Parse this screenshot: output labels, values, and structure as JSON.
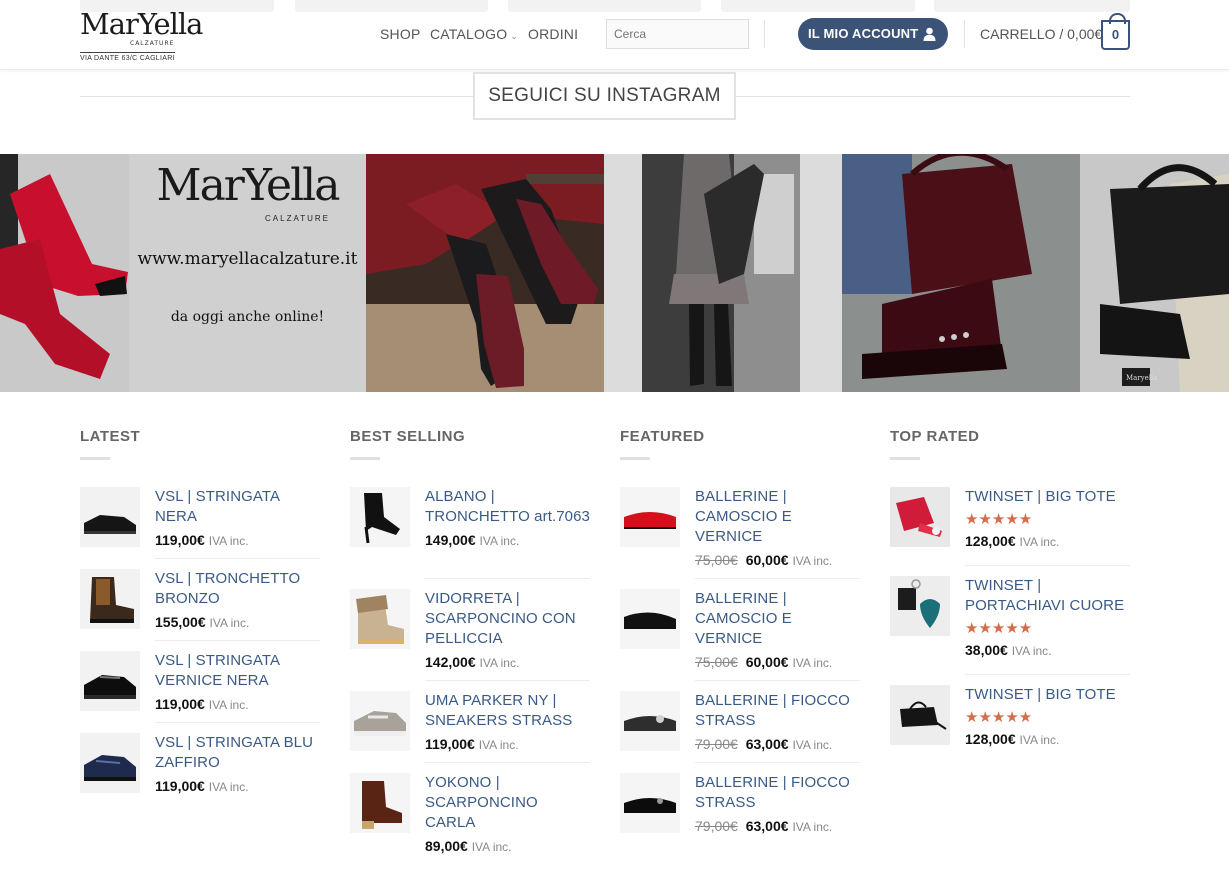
{
  "header": {
    "logo_text": "MarYella",
    "logo_subtitle": "CALZATURE",
    "logo_address": "VIA DANTE 63/C CAGLIARI",
    "nav": [
      {
        "label": "SHOP"
      },
      {
        "label": "CATALOGO"
      },
      {
        "label": "ORDINI"
      }
    ],
    "search_placeholder": "Cerca",
    "account_label": "IL MIO ACCOUNT",
    "cart_label": "CARRELLO / 0,00€",
    "cart_count": "0"
  },
  "instagram": {
    "title": "SEGUICI SU INSTAGRAM",
    "promo_logo": "MarYella",
    "promo_logo_sub": "CALZATURE",
    "promo_url": "www.maryellacalzature.it",
    "promo_tagline": "da oggi anche online!",
    "tag_label": "Maryella"
  },
  "columns": [
    {
      "title": "LATEST",
      "items": [
        {
          "name": "VSL | STRINGATA NERA",
          "price": "119,00€",
          "iva": "IVA inc."
        },
        {
          "name": "VSL | TRONCHETTO BRONZO",
          "price": "155,00€",
          "iva": "IVA inc."
        },
        {
          "name": "VSL | STRINGATA VERNICE NERA",
          "price": "119,00€",
          "iva": "IVA inc."
        },
        {
          "name": "VSL | STRINGATA BLU ZAFFIRO",
          "price": "119,00€",
          "iva": "IVA inc."
        }
      ]
    },
    {
      "title": "BEST SELLING",
      "items": [
        {
          "name": "ALBANO | TRONCHETTO art.7063",
          "price": "149,00€",
          "iva": "IVA inc."
        },
        {
          "name": "VIDORRETA | SCARPONCINO CON PELLICCIA",
          "price": "142,00€",
          "iva": "IVA inc."
        },
        {
          "name": "UMA PARKER NY | SNEAKERS STRASS",
          "price": "119,00€",
          "iva": "IVA inc."
        },
        {
          "name": "YOKONO | SCARPONCINO CARLA",
          "price": "89,00€",
          "iva": "IVA inc."
        }
      ]
    },
    {
      "title": "FEATURED",
      "items": [
        {
          "name": "BALLERINE | CAMOSCIO E VERNICE",
          "old_price": "75,00€",
          "price": "60,00€",
          "iva": "IVA inc."
        },
        {
          "name": "BALLERINE | CAMOSCIO E VERNICE",
          "old_price": "75,00€",
          "price": "60,00€",
          "iva": "IVA inc."
        },
        {
          "name": "BALLERINE | FIOCCO STRASS",
          "old_price": "79,00€",
          "price": "63,00€",
          "iva": "IVA inc."
        },
        {
          "name": "BALLERINE | FIOCCO STRASS",
          "old_price": "79,00€",
          "price": "63,00€",
          "iva": "IVA inc."
        }
      ]
    },
    {
      "title": "TOP RATED",
      "items": [
        {
          "name": "TWINSET | BIG TOTE",
          "rating": 5,
          "price": "128,00€",
          "iva": "IVA inc."
        },
        {
          "name": "TWINSET | PORTACHIAVI CUORE",
          "rating": 5,
          "price": "38,00€",
          "iva": "IVA inc."
        },
        {
          "name": "TWINSET | BIG TOTE",
          "rating": 5,
          "price": "128,00€",
          "iva": "IVA inc."
        }
      ]
    }
  ],
  "colors": {
    "accent": "#3b5377",
    "link": "#3a5a86",
    "stars": "#d26e4b"
  }
}
